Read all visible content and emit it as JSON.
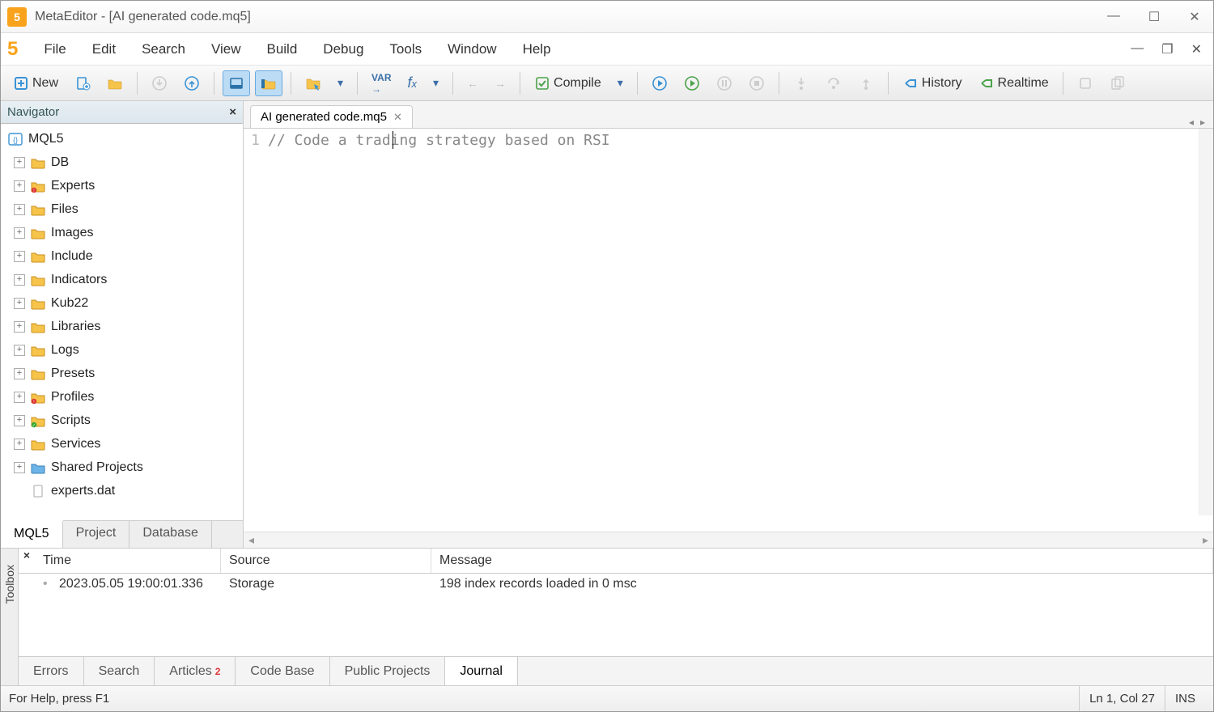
{
  "window": {
    "title": "MetaEditor - [AI generated code.mq5]"
  },
  "menubar": {
    "items": [
      "File",
      "Edit",
      "Search",
      "View",
      "Build",
      "Debug",
      "Tools",
      "Window",
      "Help"
    ]
  },
  "toolbar": {
    "new_label": "New",
    "compile_label": "Compile",
    "history_label": "History",
    "realtime_label": "Realtime"
  },
  "navigator": {
    "title": "Navigator",
    "root": "MQL5",
    "items": [
      {
        "label": "DB",
        "icon": "folder"
      },
      {
        "label": "Experts",
        "icon": "folder",
        "badge": "alert"
      },
      {
        "label": "Files",
        "icon": "folder"
      },
      {
        "label": "Images",
        "icon": "folder"
      },
      {
        "label": "Include",
        "icon": "folder"
      },
      {
        "label": "Indicators",
        "icon": "folder"
      },
      {
        "label": "Kub22",
        "icon": "folder"
      },
      {
        "label": "Libraries",
        "icon": "folder"
      },
      {
        "label": "Logs",
        "icon": "folder"
      },
      {
        "label": "Presets",
        "icon": "folder"
      },
      {
        "label": "Profiles",
        "icon": "folder",
        "badge": "alert"
      },
      {
        "label": "Scripts",
        "icon": "folder",
        "badge": "ok"
      },
      {
        "label": "Services",
        "icon": "folder"
      },
      {
        "label": "Shared Projects",
        "icon": "folder-blue"
      },
      {
        "label": "experts.dat",
        "icon": "file"
      }
    ],
    "tabs": [
      "MQL5",
      "Project",
      "Database"
    ],
    "active_tab": 0
  },
  "editor": {
    "tab_label": "AI generated code.mq5",
    "lines": [
      {
        "num": "1",
        "text": "// Code a trading strategy based on RSI"
      }
    ]
  },
  "toolbox": {
    "title": "Toolbox",
    "columns": [
      "Time",
      "Source",
      "Message"
    ],
    "rows": [
      {
        "time": "2023.05.05 19:00:01.336",
        "source": "Storage",
        "message": "198 index records loaded in 0 msc"
      }
    ],
    "tabs": [
      {
        "label": "Errors"
      },
      {
        "label": "Search"
      },
      {
        "label": "Articles",
        "badge": "2"
      },
      {
        "label": "Code Base"
      },
      {
        "label": "Public Projects"
      },
      {
        "label": "Journal"
      }
    ],
    "active_tab": 5
  },
  "statusbar": {
    "help": "For Help, press F1",
    "pos": "Ln 1, Col 27",
    "mode": "INS"
  }
}
